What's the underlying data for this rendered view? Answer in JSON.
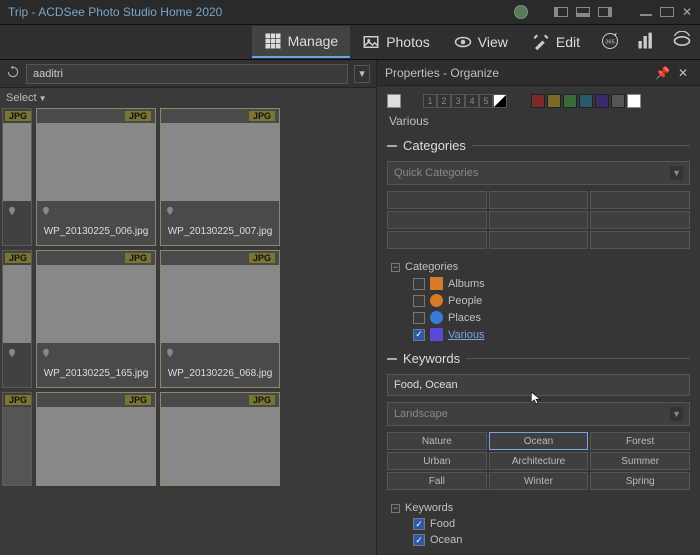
{
  "window": {
    "title": "Trip - ACDSee Photo Studio Home 2020"
  },
  "nav": {
    "manage": "Manage",
    "photos": "Photos",
    "view": "View",
    "edit": "Edit"
  },
  "pathbar": {
    "value": "aaditri"
  },
  "selectbar": {
    "label": "Select"
  },
  "thumbs": {
    "tag": "JPG",
    "items": [
      {
        "fname": "WP_20130225_006.jpg"
      },
      {
        "fname": "WP_20130225_007.jpg"
      },
      {
        "fname": "WP_20130225_165.jpg"
      },
      {
        "fname": "WP_20130226_068.jpg"
      }
    ]
  },
  "panel": {
    "title": "Properties - Organize",
    "ratings": [
      "1",
      "2",
      "3",
      "4",
      "5"
    ],
    "colors": [
      "#7a2a2a",
      "#7a6a2a",
      "#3a6a3a",
      "#2a5a6a",
      "#3a2a6a",
      "#555555",
      "#ffffff"
    ],
    "various": "Various",
    "sections": {
      "categories": "Categories",
      "keywords": "Keywords"
    },
    "quickCategories": "Quick Categories",
    "tree": {
      "root": "Categories",
      "items": [
        {
          "label": "Albums",
          "checked": false
        },
        {
          "label": "People",
          "checked": false
        },
        {
          "label": "Places",
          "checked": false
        },
        {
          "label": "Various",
          "checked": true,
          "link": true
        }
      ]
    },
    "kwInput": "Food, Ocean",
    "kwPreset": "Landscape",
    "kwGrid": [
      "Nature",
      "Ocean",
      "Forest",
      "Urban",
      "Architecture",
      "Summer",
      "Fall",
      "Winter",
      "Spring"
    ],
    "kwSelected": "Ocean",
    "kwTree": {
      "root": "Keywords",
      "items": [
        {
          "label": "Food",
          "checked": true
        },
        {
          "label": "Ocean",
          "checked": true
        }
      ]
    }
  }
}
